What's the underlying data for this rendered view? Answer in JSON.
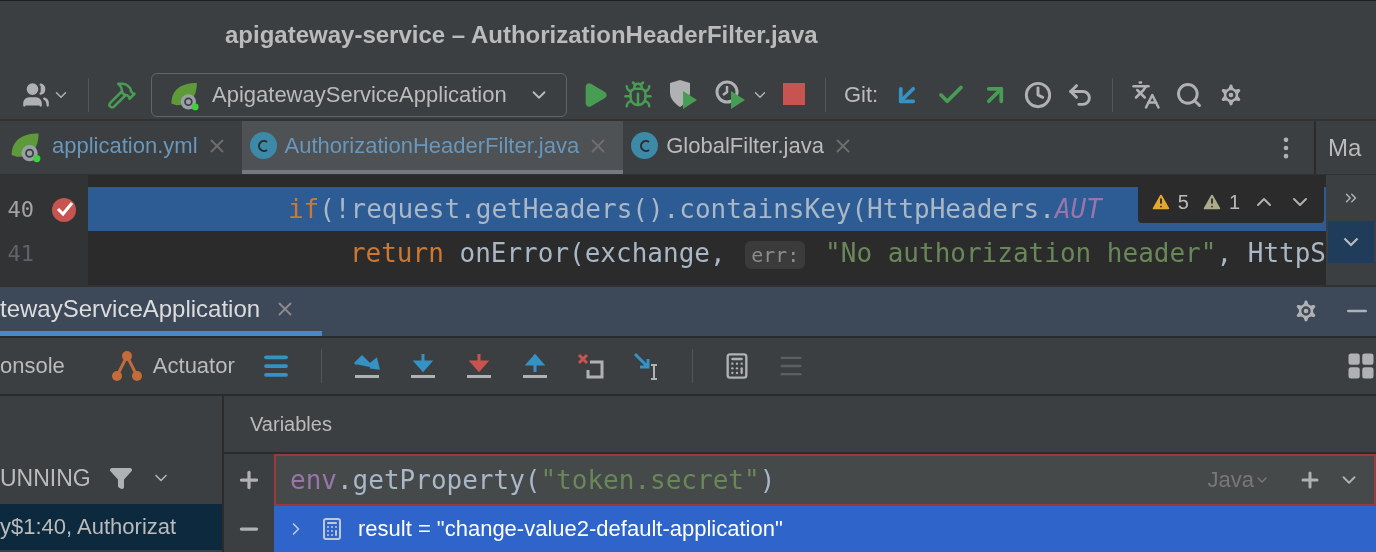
{
  "window": {
    "title": "apigateway-service – AuthorizationHeaderFilter.java"
  },
  "toolbar": {
    "run_config": "ApigatewayServiceApplication",
    "git_label": "Git:"
  },
  "editor_tabs": [
    {
      "label": "application.yml",
      "kind": "spring",
      "selected": false
    },
    {
      "label": "AuthorizationHeaderFilter.java",
      "kind": "class",
      "selected": true
    },
    {
      "label": "GlobalFilter.java",
      "kind": "class",
      "selected": false
    }
  ],
  "side_tab": "Ma",
  "editor": {
    "lines": [
      {
        "number": "40",
        "highlighted": true,
        "breakpoint": true,
        "tokens": [
          {
            "kind": "keyword",
            "text": "if"
          },
          {
            "kind": "plain",
            "text": "(!request.getHeaders().containsKey(HttpHeaders."
          },
          {
            "kind": "constant",
            "text": "AUT"
          }
        ],
        "children": [
          {
            "number": "41",
            "highlighted": false,
            "breakpoint": false,
            "tokens": [
              {
                "kind": "keyword",
                "text": "return"
              },
              {
                "kind": "plain",
                "text": " onError(exchange, "
              },
              {
                "kind": "hint",
                "text": "err:"
              },
              {
                "kind": "string",
                "text": " \"No authorization header\""
              },
              {
                "kind": "plain",
                "text": ", HttpS"
              }
            ]
          }
        ]
      }
    ],
    "warnings": "5",
    "weak_warnings": "1"
  },
  "debug": {
    "tab": {
      "label": "tewayServiceApplication",
      "selected": true
    },
    "tools": [
      {
        "label": "onsole"
      },
      {
        "label": "Actuator"
      }
    ],
    "thread": "UNNING",
    "frame": {
      "label": "y$1:40, Authorizat",
      "selected": true
    },
    "variables_title": "Variables",
    "watch": {
      "tokens": [
        {
          "kind": "field",
          "text": "env"
        },
        {
          "kind": "plain",
          "text": ".getProperty("
        },
        {
          "kind": "string",
          "text": "\"token.secret\""
        },
        {
          "kind": "plain",
          "text": ")"
        }
      ],
      "language": "Java"
    },
    "result": {
      "text": "result = \"change-value2-default-application\"",
      "selected": true
    }
  }
}
